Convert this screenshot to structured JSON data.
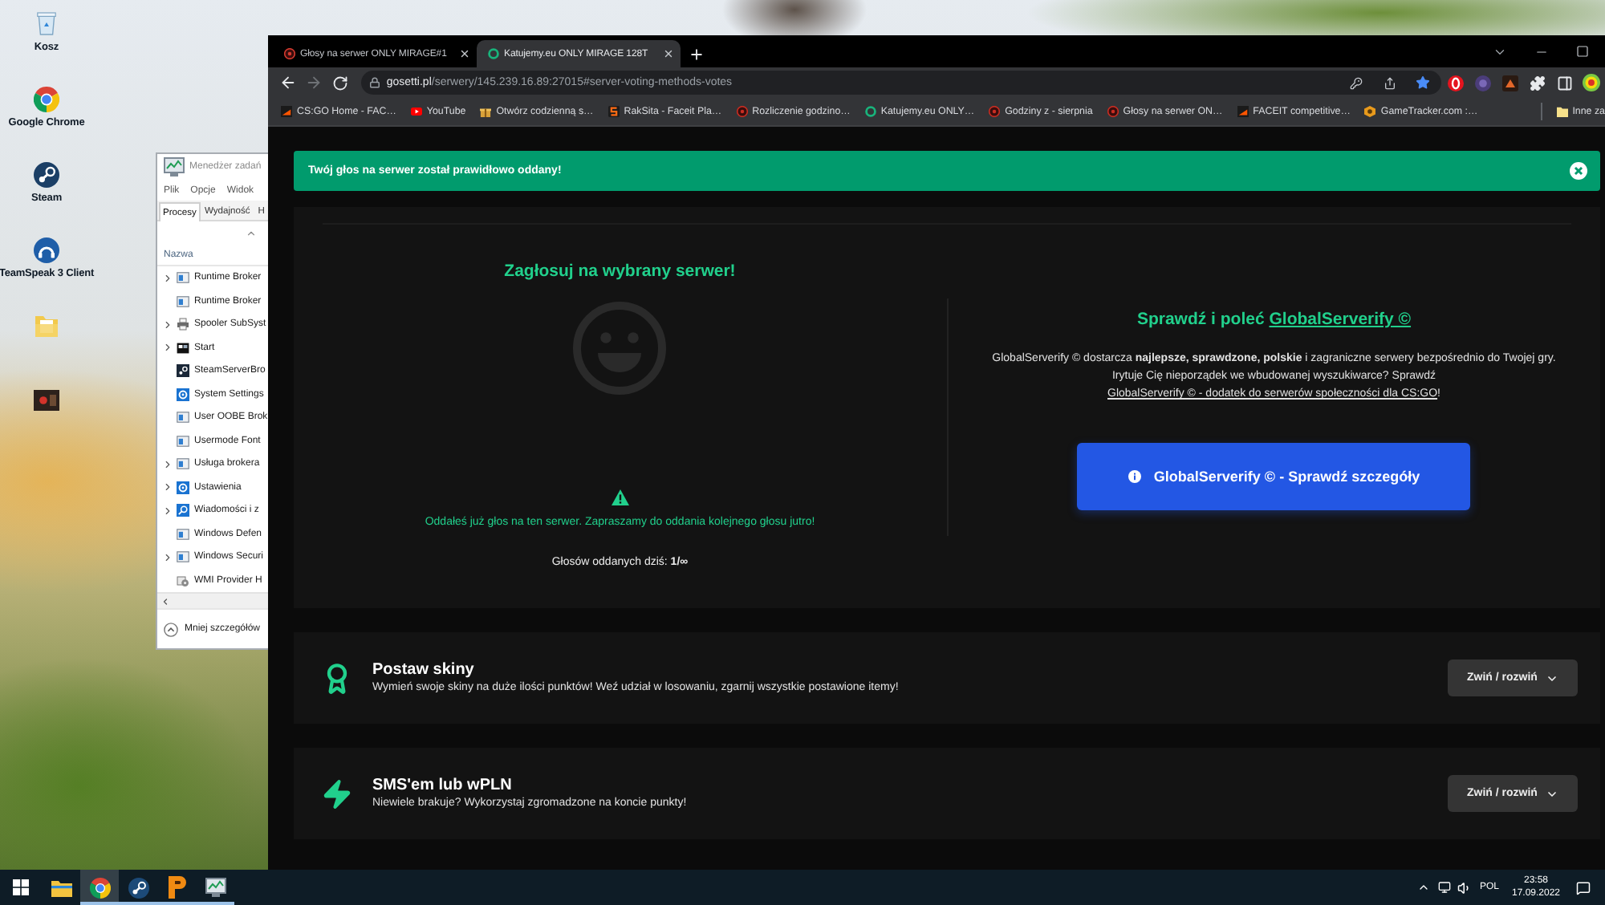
{
  "desktop": {
    "shortcuts": [
      {
        "kind": "bin",
        "label": "Kosz"
      },
      {
        "kind": "chrome",
        "label": "Google Chrome"
      },
      {
        "kind": "steam",
        "label": "Steam"
      },
      {
        "kind": "teamspeak",
        "label": "TeamSpeak 3 Client"
      },
      {
        "kind": "folder"
      },
      {
        "kind": "game"
      }
    ]
  },
  "task_manager": {
    "title": "Menedżer zadań",
    "menu": [
      "Plik",
      "Opcje",
      "Widok"
    ],
    "tabs": [
      {
        "label": "Procesy",
        "selected": true
      },
      {
        "label": "Wydajność",
        "selected": false
      },
      {
        "label": "H",
        "selected": false
      }
    ],
    "column": "Nazwa",
    "processes": [
      {
        "kind": "window",
        "name": "Runtime Broker",
        "expandable": true
      },
      {
        "kind": "window",
        "name": "Runtime Broker",
        "expandable": false
      },
      {
        "kind": "printer",
        "name": "Spooler SubSyst",
        "expandable": true
      },
      {
        "kind": "start",
        "name": "Start",
        "expandable": true
      },
      {
        "kind": "steam",
        "name": "SteamServerBro",
        "expandable": false
      },
      {
        "kind": "gear",
        "name": "System Settings",
        "expandable": false
      },
      {
        "kind": "window",
        "name": "User OOBE Brok",
        "expandable": false
      },
      {
        "kind": "window",
        "name": "Usermode Font",
        "expandable": false
      },
      {
        "kind": "window",
        "name": "Usługa brokera",
        "expandable": true
      },
      {
        "kind": "gear",
        "name": "Ustawienia",
        "expandable": true
      },
      {
        "kind": "search",
        "name": "Wiadomości i z",
        "expandable": true
      },
      {
        "kind": "window",
        "name": "Windows Defen",
        "expandable": false
      },
      {
        "kind": "window",
        "name": "Windows Securi",
        "expandable": true
      },
      {
        "kind": "service",
        "name": "WMI Provider H",
        "expandable": false
      }
    ],
    "footer": "Mniej szczegółów"
  },
  "browser": {
    "tabs": [
      {
        "kind": "dot",
        "title": "Głosy na serwer ONLY MIRAGE#1",
        "selected": false
      },
      {
        "kind": "ring",
        "title": "Katujemy.eu ONLY MIRAGE 128T",
        "selected": true
      }
    ],
    "address": {
      "host": "gosetti.pl",
      "path": "/serwery/145.239.16.89:27015#server-voting-methods-votes"
    },
    "bookmarks": [
      {
        "kind": "faceit",
        "title": "CS:GO Home - FAC…"
      },
      {
        "kind": "youtube",
        "title": "YouTube"
      },
      {
        "kind": "gift",
        "title": "Otwórz codzienną s…"
      },
      {
        "kind": "letter",
        "title": "RakSita - Faceit Pla…"
      },
      {
        "kind": "bug",
        "title": "Rozliczenie godzino…"
      },
      {
        "kind": "ring",
        "title": "Katujemy.eu ONLY…"
      },
      {
        "kind": "bug",
        "title": "Godziny z - sierpnia"
      },
      {
        "kind": "bug",
        "title": "Głosy na serwer ON…"
      },
      {
        "kind": "faceit",
        "title": "FACEIT competitive…"
      },
      {
        "kind": "badge",
        "title": "GameTracker.com :…"
      }
    ],
    "other_bookmarks": "Inne za"
  },
  "page": {
    "alert": {
      "text": "Twój głos na serwer został prawidłowo oddany!"
    },
    "vote": {
      "title": "Zagłosuj na wybrany serwer!",
      "message": "Oddałeś już głos na ten serwer. Zapraszamy do oddania kolejnego głosu jutro!",
      "count": "Głosów oddanych dziś: **1/∞**"
    },
    "promo": {
      "title": "Sprawdź i poleć",
      "title_link": "GlobalServerify ©",
      "text": "GlobalServerify © dostarcza **najlepsze, sprawdzone, polskie** i zagraniczne serwery bezpośrednio do Twojej gry. Irytuje Cię nieporządek we wbudowanej wyszukiwarce? Sprawdź",
      "link": "GlobalServerify © - dodatek do serwerów społeczności dla CS:GO",
      "text_end": "!",
      "button": "GlobalServerify © - Sprawdź szczegóły"
    },
    "sections": [
      {
        "kind": "award",
        "title": "Postaw skiny",
        "text": "Wymień swoje skiny na duże ilości punktów! Weź udział w losowaniu, zgarnij wszystkie postawione itemy!",
        "button": "Zwiń / rozwiń"
      },
      {
        "kind": "bolt",
        "title": "SMS'em lub wPLN",
        "text": "Niewiele brakuje? Wykorzystaj zgromadzone na koncie punkty!",
        "button": "Zwiń / rozwiń"
      }
    ]
  },
  "taskbar": {
    "apps": [
      {
        "kind": "explorer",
        "running": false,
        "selected": false
      },
      {
        "kind": "chrome",
        "running": true,
        "selected": true
      },
      {
        "kind": "steam",
        "running": true,
        "selected": false
      },
      {
        "kind": "launcher",
        "running": true,
        "selected": false
      },
      {
        "kind": "taskmgr",
        "running": true,
        "selected": false
      }
    ],
    "language": "POL",
    "time": "23:58",
    "date": "17.09.2022"
  }
}
